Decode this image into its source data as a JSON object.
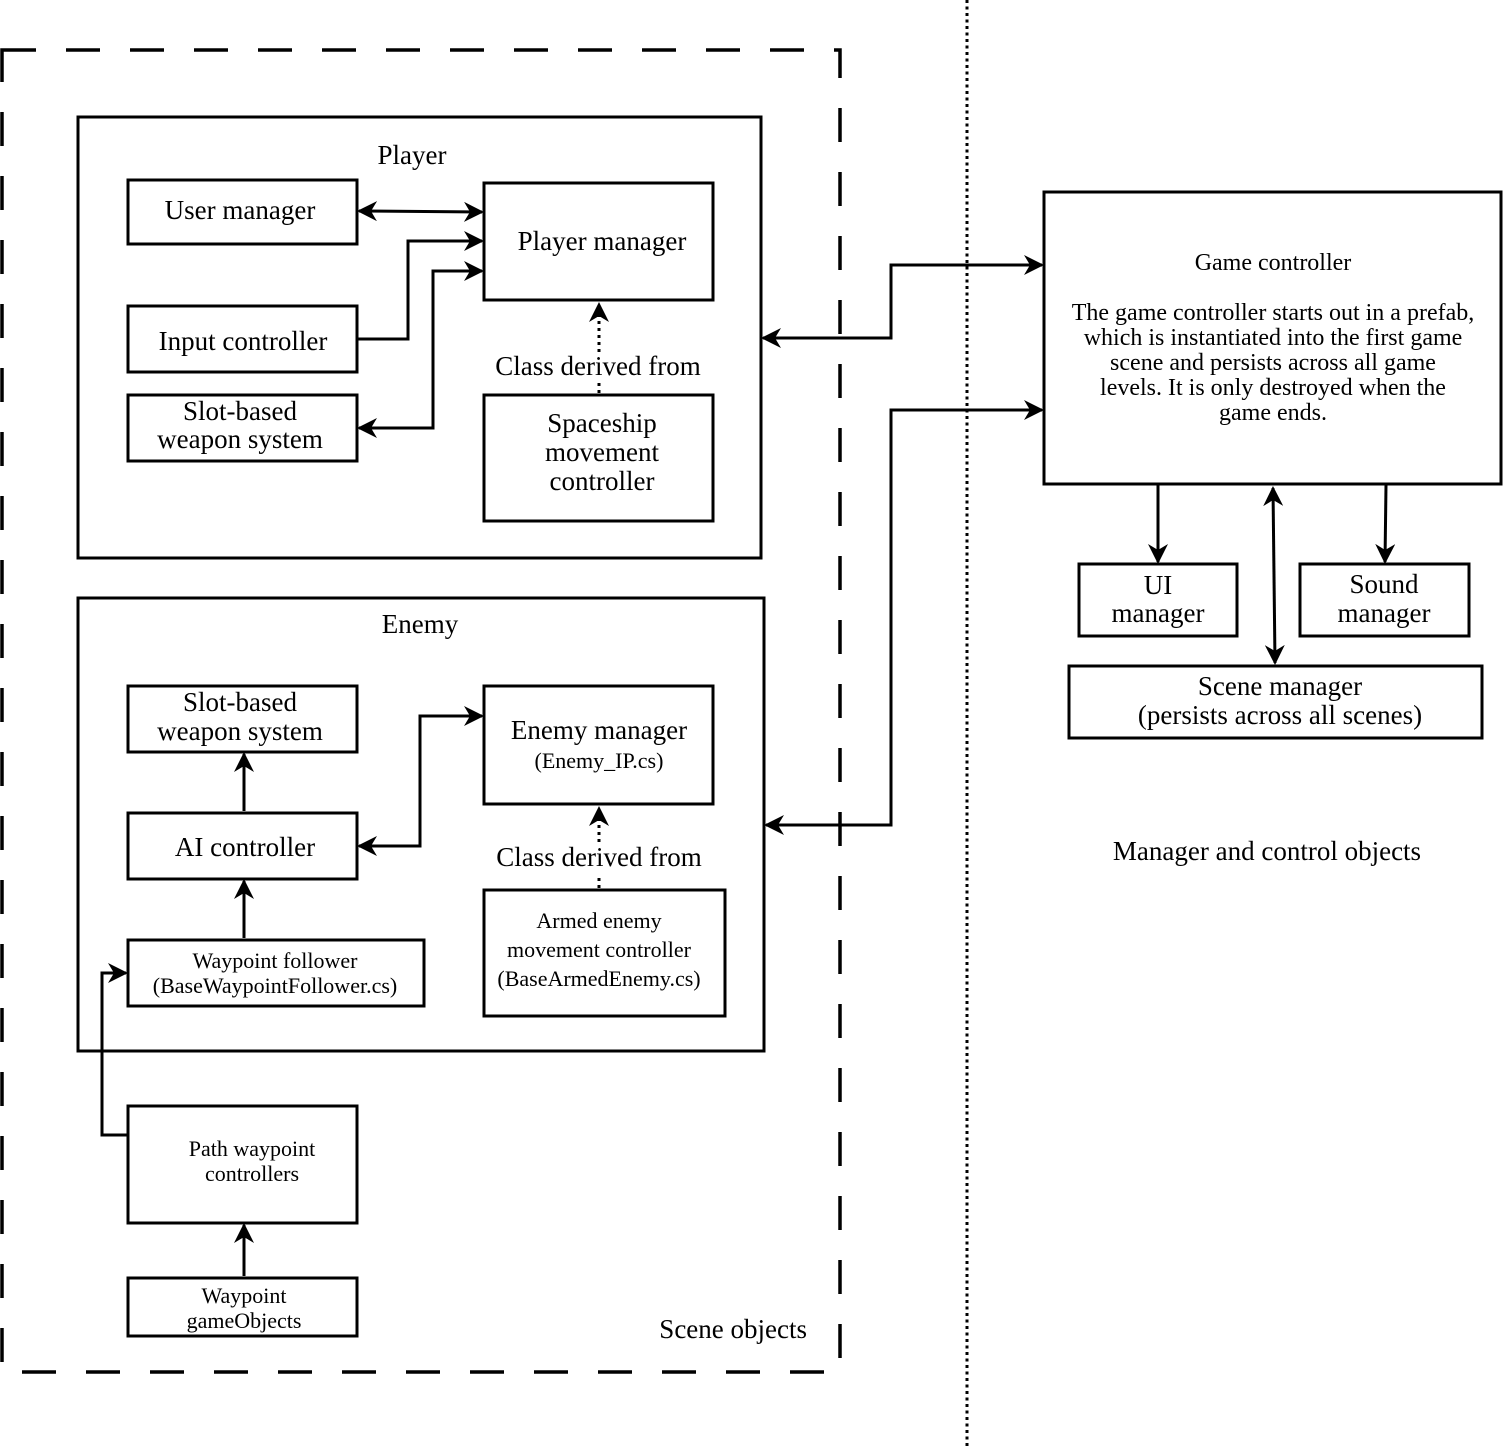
{
  "regions": {
    "scene_objects": "Scene objects",
    "manager_objects": "Manager and control objects"
  },
  "player": {
    "title": "Player",
    "user_manager": "User manager",
    "input_controller": "Input controller",
    "weapon_system": [
      "Slot-based",
      "weapon system"
    ],
    "player_manager": "Player manager",
    "class_derived": "Class derived from",
    "spaceship_controller": [
      "Spaceship",
      "movement",
      "controller"
    ]
  },
  "enemy": {
    "title": "Enemy",
    "weapon_system": [
      "Slot-based",
      "weapon system"
    ],
    "ai_controller": "AI controller",
    "waypoint_follower": [
      "Waypoint follower",
      "(BaseWaypointFollower.cs)"
    ],
    "enemy_manager": [
      "Enemy manager",
      "(Enemy_IP.cs)"
    ],
    "class_derived": "Class derived from",
    "armed_enemy": [
      "Armed enemy",
      "movement controller",
      "(BaseArmedEnemy.cs)"
    ]
  },
  "path": {
    "path_controllers": [
      "Path waypoint",
      "controllers"
    ],
    "waypoint_objects": [
      "Waypoint",
      "gameObjects"
    ]
  },
  "managers": {
    "game_controller_title": "Game controller",
    "game_controller_desc": [
      "The game controller starts out in a prefab,",
      "which is instantiated into the first game",
      "scene and persists across all game",
      "levels. It is only destroyed when the",
      "game ends."
    ],
    "ui_manager": [
      "UI",
      "manager"
    ],
    "sound_manager": [
      "Sound",
      "manager"
    ],
    "scene_manager": [
      "Scene manager",
      "(persists across all scenes)"
    ]
  }
}
